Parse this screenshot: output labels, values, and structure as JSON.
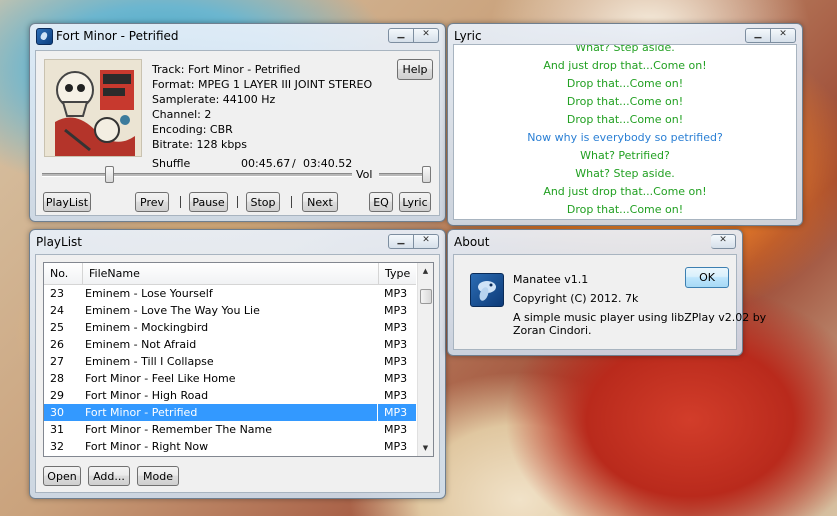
{
  "player": {
    "title": "Fort Minor - Petrified",
    "help_label": "Help",
    "track": "Track: Fort Minor - Petrified",
    "format": "Format: MPEG 1 LAYER III JOINT STEREO",
    "samplerate": "Samplerate: 44100 Hz",
    "channel": "Channel: 2",
    "encoding": "Encoding: CBR",
    "bitrate": "Bitrate: 128 kbps",
    "shuffle": "Shuffle",
    "position": "00:45.67",
    "separator": "/",
    "duration": "03:40.52",
    "vol_label": "Vol",
    "progress_fraction": 0.21,
    "volume_fraction": 1.0,
    "buttons": {
      "playlist": "PlayList",
      "prev": "Prev",
      "pause": "Pause",
      "stop": "Stop",
      "next": "Next",
      "eq": "EQ",
      "lyric": "Lyric"
    }
  },
  "lyric": {
    "title": "Lyric",
    "lines": [
      {
        "text": "What?  Step aside.",
        "current": false
      },
      {
        "text": "And just drop that...Come on!",
        "current": false
      },
      {
        "text": "Drop that...Come on!",
        "current": false
      },
      {
        "text": "Drop that...Come on!",
        "current": false
      },
      {
        "text": "Drop that...Come on!",
        "current": false
      },
      {
        "text": "Now why is everybody so petrified?",
        "current": true
      },
      {
        "text": "What?  Petrified?",
        "current": false
      },
      {
        "text": "What?  Step aside.",
        "current": false
      },
      {
        "text": "And just drop that...Come on!",
        "current": false
      },
      {
        "text": "Drop that...Come on!",
        "current": false
      }
    ],
    "colors": {
      "normal": "#22a022",
      "current": "#2a7fd4"
    }
  },
  "playlist": {
    "title": "PlayList",
    "columns": {
      "no": "No.",
      "filename": "FileName",
      "type": "Type"
    },
    "rows": [
      {
        "no": "23",
        "name": "Eminem - Lose Yourself",
        "type": "MP3"
      },
      {
        "no": "24",
        "name": "Eminem - Love The Way You Lie",
        "type": "MP3"
      },
      {
        "no": "25",
        "name": "Eminem - Mockingbird",
        "type": "MP3"
      },
      {
        "no": "26",
        "name": "Eminem - Not Afraid",
        "type": "MP3"
      },
      {
        "no": "27",
        "name": "Eminem - Till I Collapse",
        "type": "MP3"
      },
      {
        "no": "28",
        "name": "Fort Minor - Feel Like Home",
        "type": "MP3"
      },
      {
        "no": "29",
        "name": "Fort Minor - High Road",
        "type": "MP3"
      },
      {
        "no": "30",
        "name": "Fort Minor - Petrified",
        "type": "MP3",
        "selected": true
      },
      {
        "no": "31",
        "name": "Fort Minor - Remember The Name",
        "type": "MP3"
      },
      {
        "no": "32",
        "name": "Fort Minor - Right Now",
        "type": "MP3"
      }
    ],
    "buttons": {
      "open": "Open",
      "add": "Add...",
      "mode": "Mode"
    }
  },
  "about": {
    "title": "About",
    "app_name": "Manatee v1.1",
    "copyright": "Copyright (C) 2012. 7k",
    "desc_line1": "A simple music player using libZPlay v2.02 by",
    "desc_line2": "Zoran Cindori.",
    "ok_label": "OK"
  },
  "window_controls": {
    "minimize": "▁",
    "close": "✕"
  }
}
